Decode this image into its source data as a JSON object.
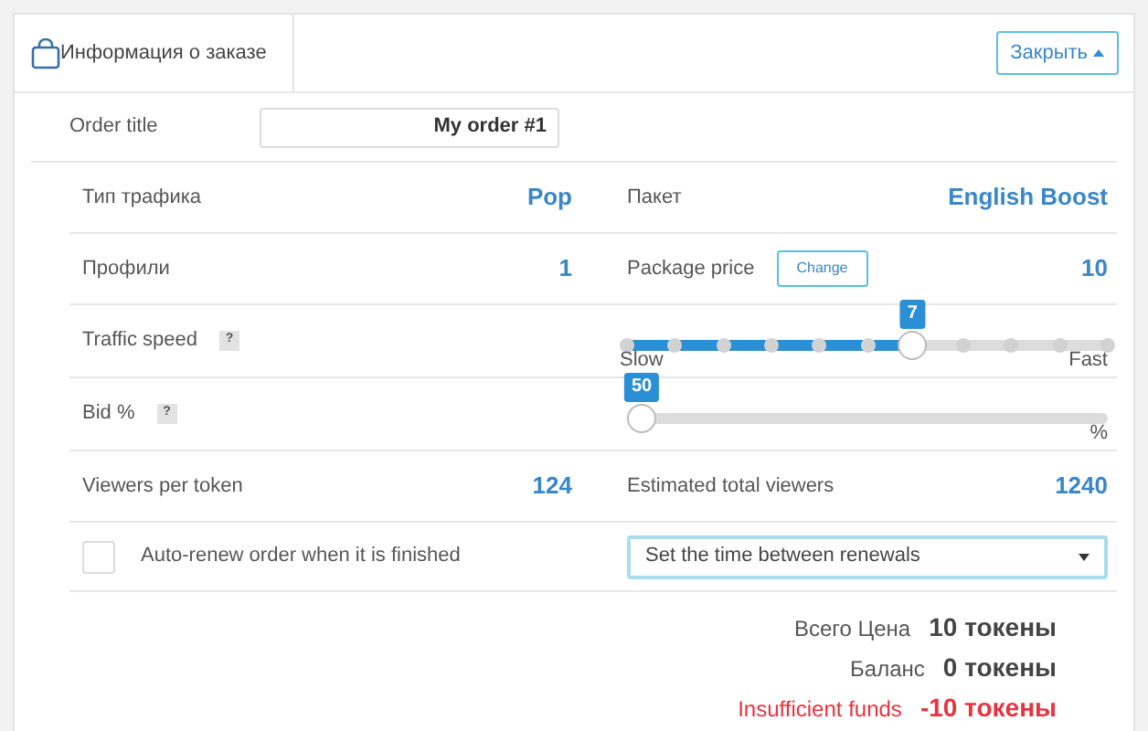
{
  "header": {
    "title": "Информация о заказе",
    "close_button": "Закрыть"
  },
  "order_title": {
    "label": "Order title",
    "value": "My order #1"
  },
  "rows": [
    {
      "kind": "pair",
      "left": {
        "label": "Тип трафика",
        "value": "Pop"
      },
      "right": {
        "label": "Пакет",
        "value": "English Boost"
      }
    },
    {
      "kind": "pair",
      "left": {
        "label": "Профили",
        "value": "1"
      },
      "right": {
        "label": "Package price",
        "button": "Change",
        "value": "10"
      }
    },
    {
      "kind": "slider",
      "label": "Traffic speed",
      "help": "?",
      "badge": "7",
      "level": 0.6,
      "stepped": true,
      "min_label": "Slow",
      "max_label": "Fast"
    },
    {
      "kind": "slider",
      "label": "Bid %",
      "help": "?",
      "badge": "50",
      "level": 0,
      "stepped": false,
      "max_label": "%"
    },
    {
      "kind": "pair",
      "left": {
        "label": "Viewers per token",
        "value": "124"
      },
      "right": {
        "label": "Estimated total viewers",
        "value": "1240"
      }
    },
    {
      "kind": "renew",
      "checked": false,
      "label": "Auto-renew order when it is finished",
      "select": "Set the time between renewals"
    }
  ],
  "summary": [
    {
      "kind": "normal",
      "label": "Всего Цена",
      "value": "10 токены"
    },
    {
      "kind": "normal",
      "label": "Баланс",
      "value": "0 токены"
    },
    {
      "kind": "error",
      "label": "Insufficient funds",
      "value": "-10 токены"
    }
  ]
}
